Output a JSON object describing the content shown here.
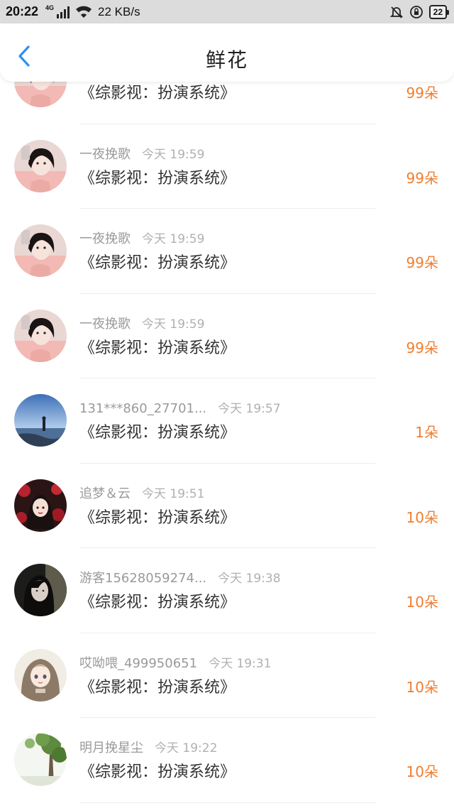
{
  "status_bar": {
    "time": "20:22",
    "network_tag": "4G",
    "speed": "22 KB/s",
    "battery": "22"
  },
  "nav": {
    "title": "鲜花"
  },
  "colors": {
    "accent_blue": "#2f8ff0",
    "amount_orange": "#f07d2e"
  },
  "items": [
    {
      "name": "",
      "time": "",
      "book": "《综影视：扮演系统》",
      "amount": "99朵",
      "avatar": "girl-pink"
    },
    {
      "name": "一夜挽歌",
      "time": "今天 19:59",
      "book": "《综影视：扮演系统》",
      "amount": "99朵",
      "avatar": "girl-pink"
    },
    {
      "name": "一夜挽歌",
      "time": "今天 19:59",
      "book": "《综影视：扮演系统》",
      "amount": "99朵",
      "avatar": "girl-pink"
    },
    {
      "name": "一夜挽歌",
      "time": "今天 19:59",
      "book": "《综影视：扮演系统》",
      "amount": "99朵",
      "avatar": "girl-pink"
    },
    {
      "name": "131***860_27701...",
      "time": "今天 19:57",
      "book": "《综影视：扮演系统》",
      "amount": "1朵",
      "avatar": "sea"
    },
    {
      "name": "追梦＆云",
      "time": "今天 19:51",
      "book": "《综影视：扮演系统》",
      "amount": "10朵",
      "avatar": "anime-red"
    },
    {
      "name": "游客15628059274...",
      "time": "今天 19:38",
      "book": "《综影视：扮演系统》",
      "amount": "10朵",
      "avatar": "girl-dark"
    },
    {
      "name": "哎呦喂_499950651",
      "time": "今天 19:31",
      "book": "《综影视：扮演系统》",
      "amount": "10朵",
      "avatar": "anime-cream"
    },
    {
      "name": "明月挽星尘",
      "time": "今天 19:22",
      "book": "《综影视：扮演系统》",
      "amount": "10朵",
      "avatar": "tree"
    }
  ]
}
